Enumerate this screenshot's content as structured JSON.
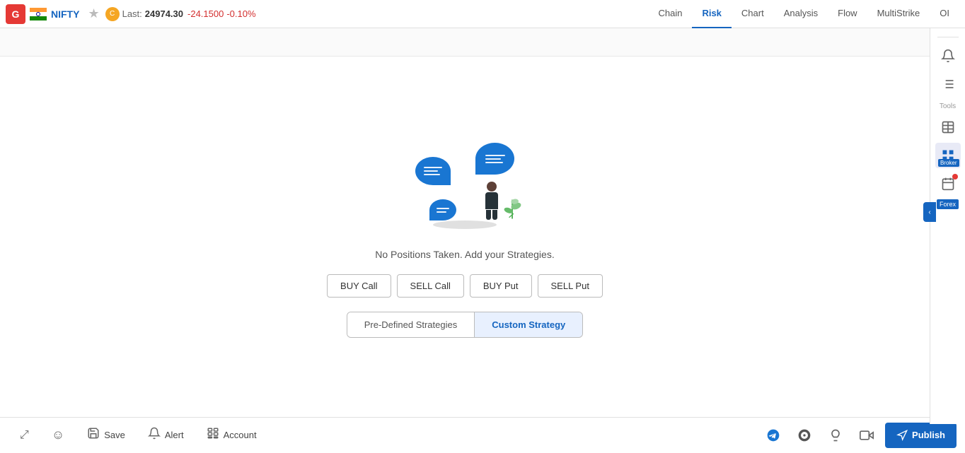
{
  "app": {
    "logo_letter": "G",
    "ticker": "NIFTY",
    "last_label": "Last:",
    "price": "24974.30",
    "change": "-24.1500",
    "change_pct": "-0.10%"
  },
  "nav": {
    "links": [
      {
        "id": "chain",
        "label": "Chain",
        "active": false
      },
      {
        "id": "risk",
        "label": "Risk",
        "active": true
      },
      {
        "id": "chart",
        "label": "Chart",
        "active": false
      },
      {
        "id": "analysis",
        "label": "Analysis",
        "active": false
      },
      {
        "id": "flow",
        "label": "Flow",
        "active": false
      },
      {
        "id": "multistrike",
        "label": "MultiStrike",
        "active": false
      },
      {
        "id": "oi",
        "label": "OI",
        "active": false
      }
    ]
  },
  "main": {
    "no_positions_text": "No Positions Taken. Add your Strategies.",
    "action_buttons": [
      {
        "id": "buy-call",
        "label": "BUY Call"
      },
      {
        "id": "sell-call",
        "label": "SELL Call"
      },
      {
        "id": "buy-put",
        "label": "BUY Put"
      },
      {
        "id": "sell-put",
        "label": "SELL Put"
      }
    ],
    "strategy_buttons": [
      {
        "id": "pre-defined",
        "label": "Pre-Defined Strategies",
        "active": false
      },
      {
        "id": "custom",
        "label": "Custom Strategy",
        "active": true
      }
    ]
  },
  "sidebar": {
    "tools_label": "Tools",
    "broker_label": "Broker",
    "forex_label": "Forex"
  },
  "bottom_bar": {
    "buttons": [
      {
        "id": "expand",
        "label": "",
        "icon": "⤢"
      },
      {
        "id": "emoji",
        "label": "",
        "icon": "☺"
      },
      {
        "id": "save",
        "label": "Save",
        "icon": "☁"
      },
      {
        "id": "alert",
        "label": "Alert",
        "icon": "🔔"
      },
      {
        "id": "account",
        "label": "Account",
        "icon": "📋"
      }
    ],
    "right_icons": [
      {
        "id": "telegram",
        "icon": "✈"
      },
      {
        "id": "circle",
        "icon": "●"
      },
      {
        "id": "bulb",
        "icon": "💡"
      },
      {
        "id": "video",
        "icon": "📹"
      },
      {
        "id": "megaphone",
        "icon": "📢"
      }
    ],
    "publish_label": "Publish"
  }
}
